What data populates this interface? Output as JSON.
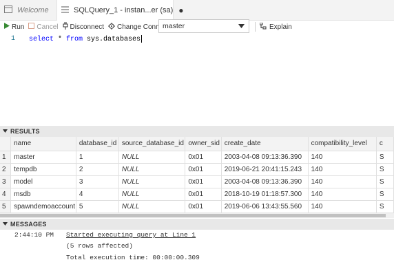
{
  "tabs": [
    {
      "label": "Welcome",
      "icon": "window-icon",
      "active": false
    },
    {
      "label": "SQLQuery_1 - instan...er (sa)",
      "icon": "menu-lines-icon",
      "active": true,
      "dirty_marker": "●"
    }
  ],
  "toolbar": {
    "run": "Run",
    "cancel": "Cancel",
    "disconnect": "Disconnect",
    "change_connection": "Change Connection",
    "database": "master",
    "explain": "Explain"
  },
  "editor": {
    "line_number": "1",
    "keyword_select": "select",
    "text_star": " * ",
    "keyword_from": "from",
    "text_rest": " sys.databases"
  },
  "results": {
    "title": "RESULTS",
    "columns": [
      "name",
      "database_id",
      "source_database_id",
      "owner_sid",
      "create_date",
      "compatibility_level",
      "c"
    ],
    "rows": [
      {
        "num": "1",
        "name": "master",
        "database_id": "1",
        "source_database_id": "NULL",
        "owner_sid": "0x01",
        "create_date": "2003-04-08 09:13:36.390",
        "compatibility_level": "140",
        "c": "S"
      },
      {
        "num": "2",
        "name": "tempdb",
        "database_id": "2",
        "source_database_id": "NULL",
        "owner_sid": "0x01",
        "create_date": "2019-06-21 20:41:15.243",
        "compatibility_level": "140",
        "c": "S"
      },
      {
        "num": "3",
        "name": "model",
        "database_id": "3",
        "source_database_id": "NULL",
        "owner_sid": "0x01",
        "create_date": "2003-04-08 09:13:36.390",
        "compatibility_level": "140",
        "c": "S"
      },
      {
        "num": "4",
        "name": "msdb",
        "database_id": "4",
        "source_database_id": "NULL",
        "owner_sid": "0x01",
        "create_date": "2018-10-19 01:18:57.300",
        "compatibility_level": "140",
        "c": "S"
      },
      {
        "num": "5",
        "name": "spawndemoaccount",
        "database_id": "5",
        "source_database_id": "NULL",
        "owner_sid": "0x01",
        "create_date": "2019-06-06 13:43:55.560",
        "compatibility_level": "140",
        "c": "S"
      }
    ]
  },
  "messages": {
    "title": "MESSAGES",
    "time": "2:44:10 PM",
    "lines": [
      "Started executing query at Line 1",
      "(5 rows affected)",
      "Total execution time: 00:00:00.309"
    ]
  },
  "colors": {
    "keyword": "#0000ff",
    "line_number": "#237893",
    "run_icon": "#388a34"
  }
}
